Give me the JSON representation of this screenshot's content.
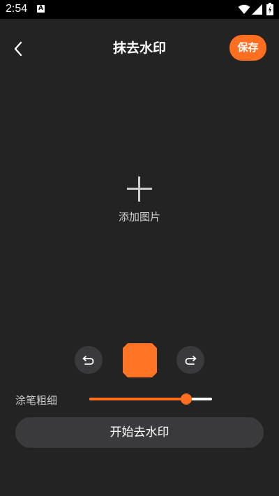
{
  "status_bar": {
    "time": "2:54",
    "notification_icon": "A",
    "icons": [
      "wifi-icon",
      "signal-icon",
      "battery-icon"
    ]
  },
  "header": {
    "back_icon": "chevron-left-icon",
    "title": "抹去水印",
    "save_label": "保存"
  },
  "canvas": {
    "add_icon": "plus-icon",
    "add_label": "添加图片"
  },
  "tools": {
    "undo_icon": "undo-icon",
    "redo_icon": "redo-icon",
    "brush_color": "#ff7324"
  },
  "brush_size": {
    "label": "涂笔粗细",
    "value": 0.79
  },
  "action": {
    "start_label": "开始去水印"
  },
  "colors": {
    "accent": "#ff6f1f",
    "background": "#232323",
    "button_bg": "#3a3a3c"
  }
}
